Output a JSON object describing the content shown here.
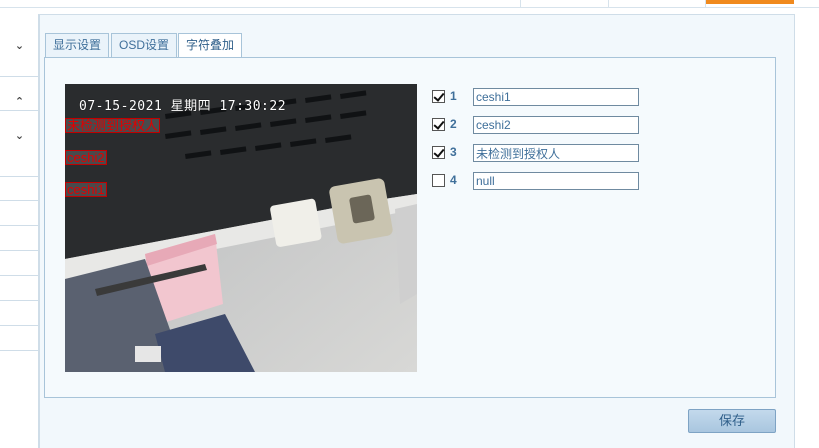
{
  "tabs": [
    {
      "label": "显示设置"
    },
    {
      "label": "OSD设置"
    },
    {
      "label": "字符叠加"
    }
  ],
  "active_tab": "字符叠加",
  "preview": {
    "datetime": "07-15-2021 星期四 17:30:22",
    "overlays": [
      "未检测到授权人",
      "ceshi2",
      "ceshi1"
    ]
  },
  "text_rows": [
    {
      "num": "1",
      "checked": true,
      "value": "ceshi1"
    },
    {
      "num": "2",
      "checked": true,
      "value": "ceshi2"
    },
    {
      "num": "3",
      "checked": true,
      "value": "未检测到授权人"
    },
    {
      "num": "4",
      "checked": false,
      "value": "null"
    }
  ],
  "save_label": "保存",
  "colors": {
    "accent": "#f08a1e",
    "panel_bg": "#f2f8fc",
    "overlay_red": "#e00000"
  }
}
